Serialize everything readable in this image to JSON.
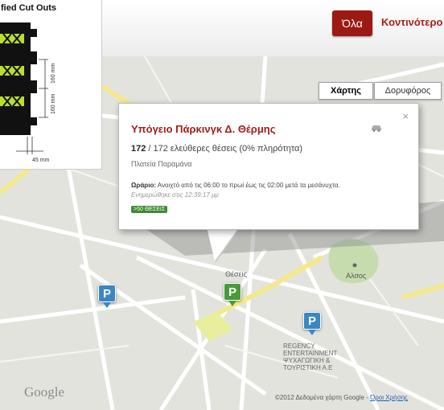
{
  "header": {
    "filter_all": "Όλα",
    "filter_nearest": "Κοντινότερο"
  },
  "map": {
    "type_map": "Χάρτης",
    "type_satellite": "Δορυφόρος",
    "google_logo": "Google",
    "copyright": "©2012 Δεδομένα χάρτη Google - ",
    "terms": "Όροι Χρήσης",
    "street_labels": [
      "Θέσεις",
      "Αλσος"
    ],
    "landmark_lines": [
      "REGENCY",
      "ENTERTAINMENT",
      "ΨΥΧΑΓΩΓΙΚΗ &",
      "ΤΟΥΡΙΣΤΙΚΗ Α.Ε"
    ],
    "pins": [
      {
        "label": "P",
        "color": "#3b86c4"
      },
      {
        "label": "P",
        "color": "#4a9a3a"
      },
      {
        "label": "P",
        "color": "#3b86c4"
      }
    ]
  },
  "infowindow": {
    "title": "Υπόγειο Πάρκινγκ Δ. Θέρμης",
    "free_spaces": "172",
    "capacity_rest": " / 172 ελεύθερες θέσεις (0% πληρότητα)",
    "area": "Πλατεία Παραμάνα",
    "hours_label": "Ωράριο:",
    "hours_text": " Ανοιχτό από τις 06:00 το πρωί έως τις 02:00 μετά τα μεσάνυχτα.",
    "updated": "Ενημερώθηκε στις 12:39:17 μμ",
    "badge": ">50 ΘΕΣΕΙΣ",
    "close_icon": "×",
    "car_icon": "car-icon"
  },
  "inset": {
    "title": "fied Cut Outs",
    "dimensions": [
      "160 mm",
      "160 mm",
      "45 mm"
    ]
  },
  "colors": {
    "accent": "#9b1a14",
    "title_red": "#a02018",
    "pin_blue": "#3b86c4",
    "pin_green": "#4a9a3a"
  }
}
